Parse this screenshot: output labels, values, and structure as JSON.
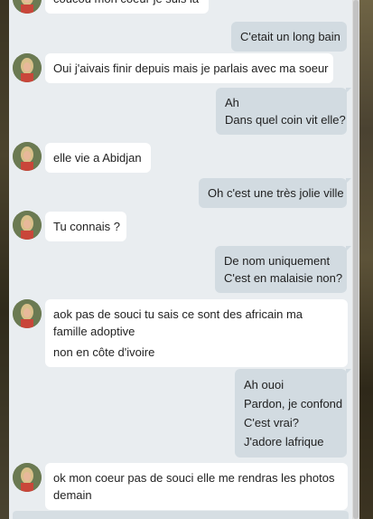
{
  "avatar_icon": "contact-avatar-icon",
  "messages": [
    {
      "dir": "in",
      "lines": [
        "coucou mon coeur je suis là"
      ]
    },
    {
      "dir": "out",
      "lines": [
        "C'etait un long bain"
      ]
    },
    {
      "dir": "in",
      "lines": [
        "Oui j'aivais finir depuis mais je parlais avec ma soeur"
      ]
    },
    {
      "dir": "out",
      "lines": [
        "Ah",
        "Dans quel coin vit elle?"
      ]
    },
    {
      "dir": "in",
      "lines": [
        "elle vie a Abidjan"
      ]
    },
    {
      "dir": "out",
      "lines": [
        "Oh c'est une très jolie ville"
      ]
    },
    {
      "dir": "in",
      "lines": [
        "Tu connais ?"
      ]
    },
    {
      "dir": "out",
      "lines": [
        "De nom uniquement",
        "C'est en malaisie non?"
      ]
    },
    {
      "dir": "in",
      "lines": [
        "aok pas de souci tu sais ce sont des africain ma famille adoptive",
        "non en côte d'ivoire"
      ]
    },
    {
      "dir": "out",
      "lines": [
        "Ah ouoi",
        "Pardon, je confond",
        "C'est vrai?",
        "J'adore lafrique"
      ]
    },
    {
      "dir": "in",
      "lines": [
        "ok mon coeur pas de souci elle me rendras les photos demain"
      ]
    }
  ]
}
